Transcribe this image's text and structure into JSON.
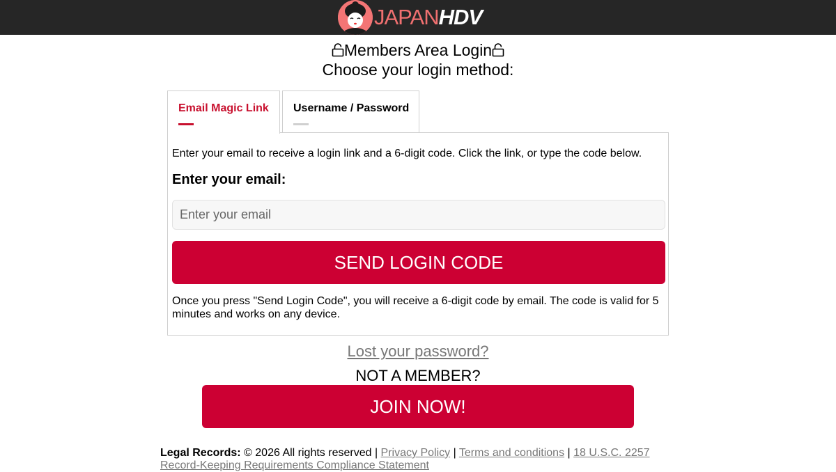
{
  "header": {
    "logo_text_a": "JAPAN",
    "logo_text_b": "HDV",
    "logo_icon": "geisha-face-icon",
    "bg_color": "#262626",
    "logo_accent": "#f07070"
  },
  "titles": {
    "members": "Members Area Login",
    "choose": "Choose your login method:",
    "lock_icon": "lock-icon"
  },
  "tabs": [
    {
      "label": "Email Magic Link",
      "active": true
    },
    {
      "label": "Username / Password",
      "active": false
    }
  ],
  "panel": {
    "intro": "Enter your email to receive a login link and a 6-digit code. Click the link, or type the code below.",
    "email_label": "Enter your email:",
    "email_placeholder": "Enter your email",
    "email_value": "",
    "send_button": "SEND LOGIN CODE",
    "note": "Once you press \"Send Login Code\", you will receive a 6-digit code by email. The code is valid for 5 minutes and works on any device."
  },
  "lost_password": "Lost your password?",
  "not_member": "NOT A MEMBER?",
  "join_button": "JOIN NOW!",
  "footer": {
    "legal_label": "Legal Records:",
    "copyright": "© 2026 All rights reserved",
    "privacy": "Privacy Policy",
    "terms": "Terms and conditions",
    "usc": "18 U.S.C. 2257",
    "record": "Record-Keeping Requirements Compliance Statement"
  },
  "colors": {
    "accent": "#cc0033",
    "tab_active": "#c8102e"
  }
}
